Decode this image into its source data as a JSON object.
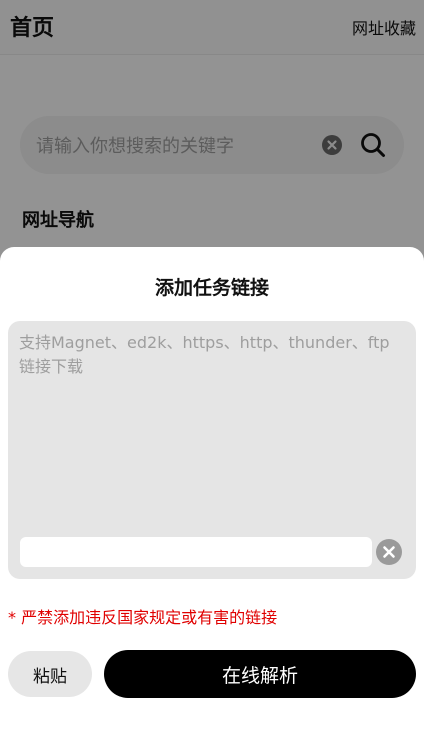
{
  "header": {
    "title": "首页",
    "bookmarks_label": "网址收藏"
  },
  "search": {
    "placeholder": "请输入你想搜索的关键字",
    "value": ""
  },
  "nav": {
    "section_title": "网址导航"
  },
  "sheet": {
    "title": "添加任务链接",
    "link_placeholder": "支持Magnet、ed2k、https、http、thunder、ftp链接下载",
    "link_value": "",
    "extra_value": "",
    "warning": "* 严禁添加违反国家规定或有害的链接",
    "paste_label": "粘贴",
    "parse_label": "在线解析"
  },
  "colors": {
    "overlay": "rgba(0,0,0,0.4)",
    "warning": "#e00000",
    "primary_button": "#000000"
  },
  "icons": {
    "clear_search": "close-circle-icon",
    "search": "search-icon",
    "clear_link": "close-circle-icon"
  }
}
